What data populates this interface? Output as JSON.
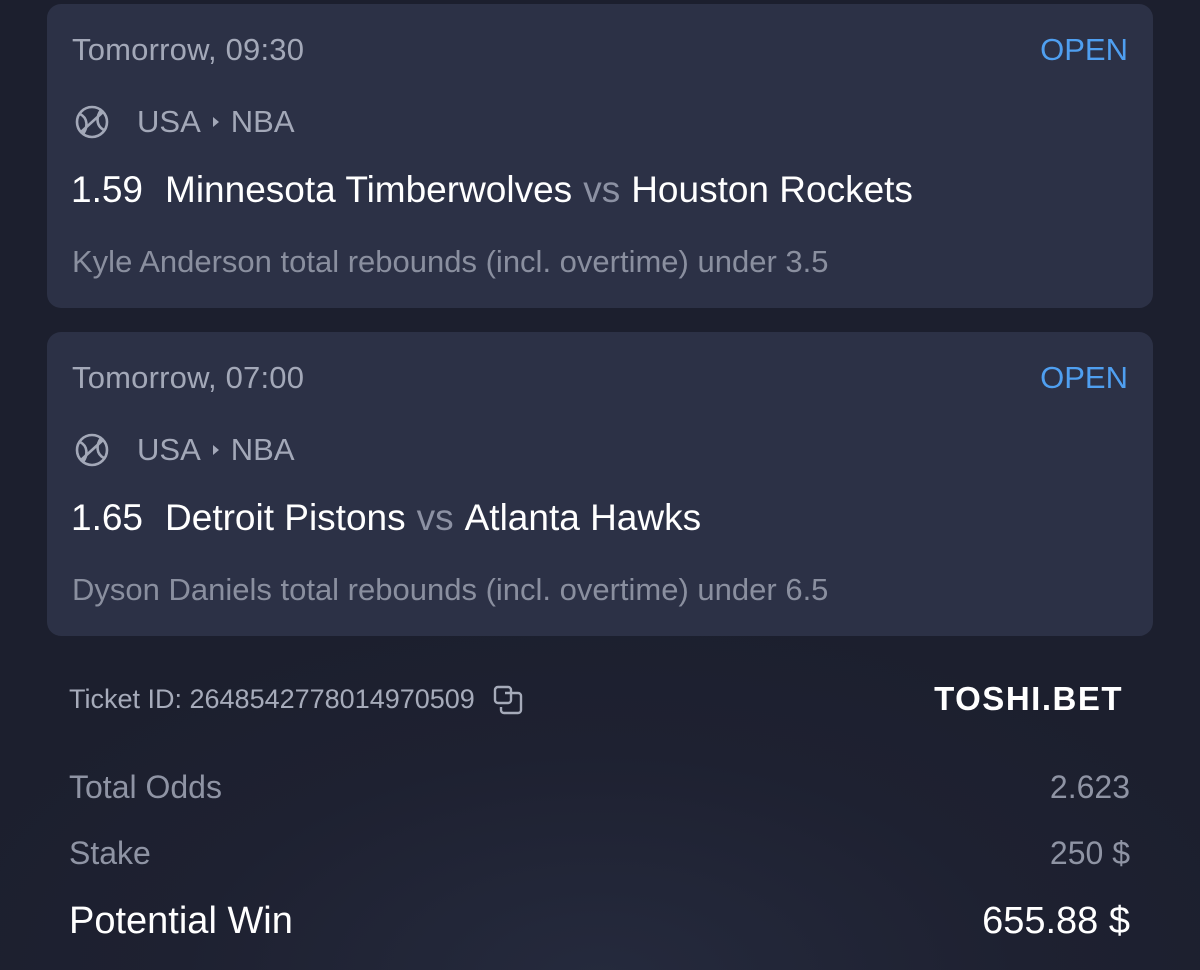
{
  "bets": [
    {
      "time": "Tomorrow, 09:30",
      "status": "OPEN",
      "country": "USA",
      "competition": "NBA",
      "sport_icon": "basketball-icon",
      "odds": "1.59",
      "home": "Minnesota Timberwolves",
      "vs": "vs",
      "away": "Houston Rockets",
      "market": "Kyle Anderson total rebounds (incl. overtime) under 3.5"
    },
    {
      "time": "Tomorrow, 07:00",
      "status": "OPEN",
      "country": "USA",
      "competition": "NBA",
      "sport_icon": "basketball-icon",
      "odds": "1.65",
      "home": "Detroit Pistons",
      "vs": "vs",
      "away": "Atlanta Hawks",
      "market": "Dyson Daniels total rebounds (incl. overtime) under 6.5"
    }
  ],
  "ticket": {
    "id_text": "Ticket ID: 2648542778014970509",
    "brand": "TOSHI.BET"
  },
  "summary": {
    "total_odds_label": "Total Odds",
    "total_odds_value": "2.623",
    "stake_label": "Stake",
    "stake_value": "250 $",
    "win_label": "Potential Win",
    "win_value": "655.88 $"
  },
  "colors": {
    "background": "#1d2030",
    "card": "#2c3146",
    "status_open": "#4f9ff0",
    "muted_text": "#8a8f9f"
  }
}
